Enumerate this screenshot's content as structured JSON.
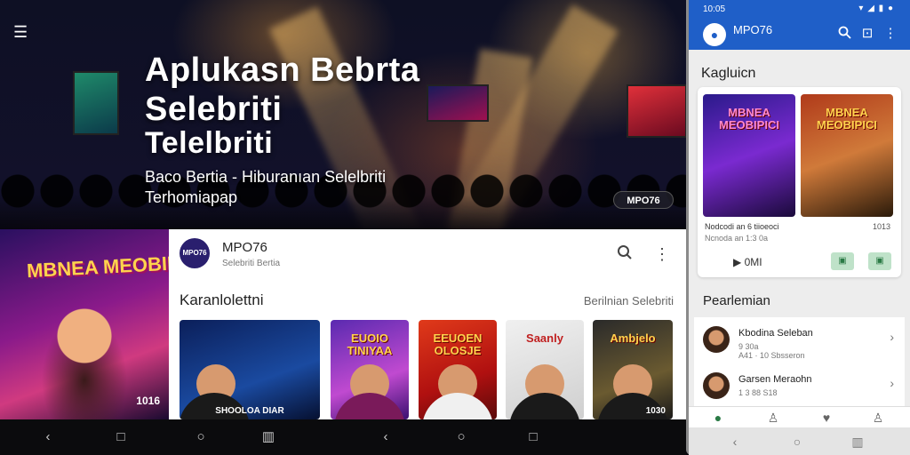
{
  "hero": {
    "title_line1": "Aplukasn Bebrta",
    "title_line2": "Selebriti",
    "title_line3": "Telelbriti",
    "subtitle_line1": "Baco Bertia - Hiburanıan Selelbriti",
    "subtitle_line2": "Terhomiapap",
    "badge": "MPO76"
  },
  "left_poster": {
    "title": "MBNEA MEOBIPICI",
    "number": "1016"
  },
  "tablet": {
    "app_name": "MPO76",
    "app_subtitle": "Selebriti Bertia",
    "logo_text": "MPO76",
    "section_title": "Karanlolettni",
    "section_link": "Berilnian Selebriti",
    "thumbnails": [
      {
        "title": "",
        "caption": "SHOOLOA DIAR"
      },
      {
        "title": "EUOIO TINIYAA",
        "caption": ""
      },
      {
        "title": "EEUOEN OLOSJE",
        "caption": ""
      },
      {
        "title": "Saanly",
        "caption": ""
      },
      {
        "title": "Ambjelo",
        "caption": "1030"
      }
    ]
  },
  "nav": {
    "back": "‹",
    "home": "○",
    "recent": "□"
  },
  "phone": {
    "status_time": "10:05",
    "status_icons": "▾ ◢ ▮ ●",
    "app_name": "MPO76",
    "app_sub": "",
    "section1": "Kagluicn",
    "card": {
      "thumb1_title": "MBNEA MEOBIPICI",
      "thumb2_title": "MBNEA MEOBIPICI",
      "meta1": "Nodcodi an 6 tiioeoci",
      "meta2": "Ncnoda an 1:3 0a",
      "meta3": "1013",
      "play_label": "0MI"
    },
    "section2": "Pearlemian",
    "list": [
      {
        "name": "Kbodina Seleban",
        "detail1": "9 30a",
        "detail2": "A41 · 10 Sbsseron"
      },
      {
        "name": "Garsen Meraohn",
        "detail1": "1 3 88 S18",
        "detail2": ""
      }
    ]
  },
  "colors": {
    "brand_blue": "#1f5fc8",
    "accent_gold": "#ffd34d",
    "card_bg": "#ffffff"
  }
}
